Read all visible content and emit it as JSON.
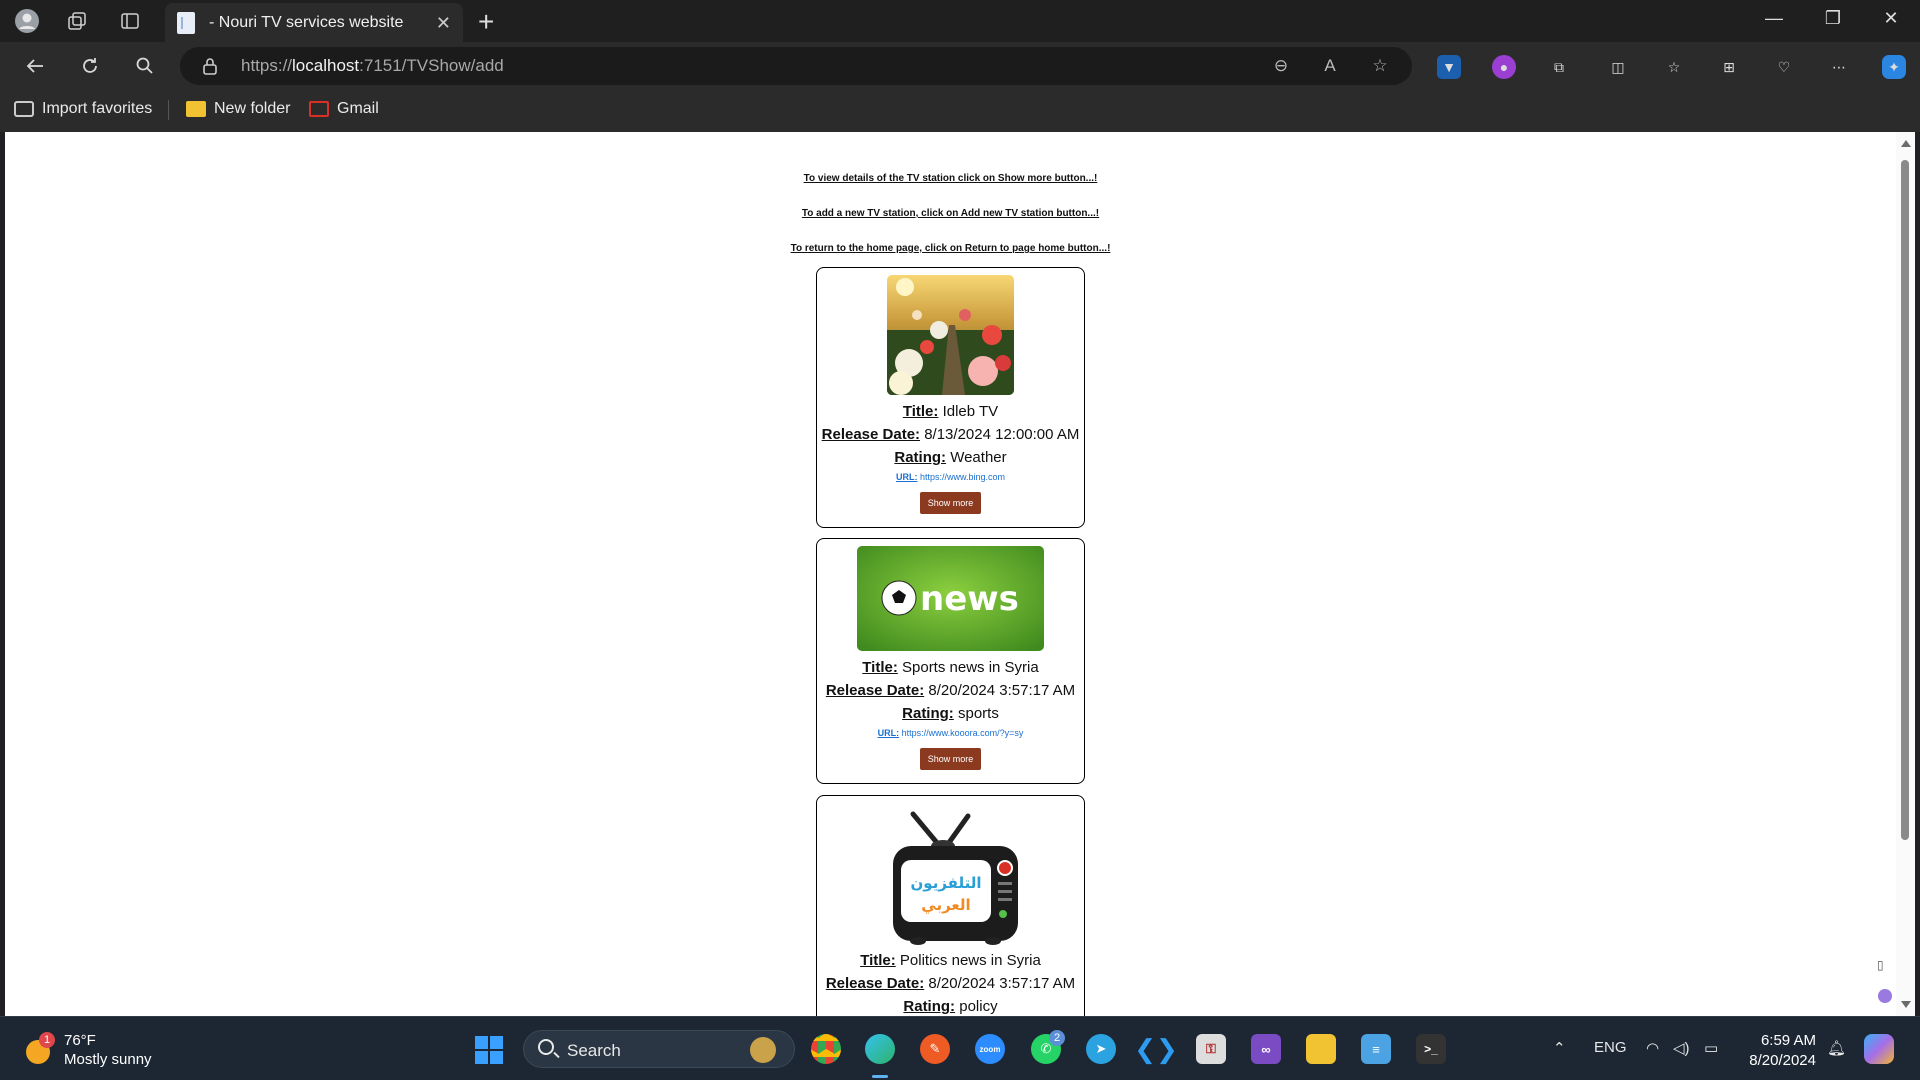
{
  "browser": {
    "tab_title": "- Nouri TV services website",
    "url_prefix": "https://",
    "url_host": "localhost",
    "url_rest": ":7151/TVShow/add",
    "bookmarks": [
      {
        "label": "Import favorites"
      },
      {
        "label": "New folder"
      },
      {
        "label": "Gmail"
      }
    ]
  },
  "page": {
    "hints": [
      "To view details of the TV station click on Show more button...!",
      "To add a new TV station, click on Add new TV station button...!",
      "To return to the home page, click on Return to page home button...!"
    ],
    "labels": {
      "title": "Title:",
      "release_date": "Release Date:",
      "rating": "Rating:",
      "url": "URL:"
    },
    "show_more_label": "Show more",
    "stations": [
      {
        "title": "Idleb TV",
        "release_date": "8/13/2024 12:00:00 AM",
        "rating": "Weather",
        "url": "https://www.bing.com",
        "image": "flower-garden"
      },
      {
        "title": "Sports news in Syria",
        "release_date": "8/20/2024 3:57:17 AM",
        "rating": "sports",
        "url": "https://www.kooora.com/?y=sy",
        "image": "news-soccer",
        "image_text": "news"
      },
      {
        "title": "Politics news in Syria",
        "release_date": "8/20/2024 3:57:17 AM",
        "rating": "policy",
        "image": "arabic-tv",
        "image_text_line1": "التلفزيون",
        "image_text_line2": "العربي"
      }
    ]
  },
  "taskbar": {
    "weather_temp": "76°F",
    "weather_desc": "Mostly sunny",
    "weather_badge": "1",
    "search_label": "Search",
    "whatsapp_badge": "2",
    "zoom_label": "zoom",
    "language": "ENG",
    "time": "6:59 AM",
    "date": "8/20/2024"
  },
  "colors": {
    "show_more_button": "#8b3a1f",
    "link": "#1a6fd0"
  }
}
